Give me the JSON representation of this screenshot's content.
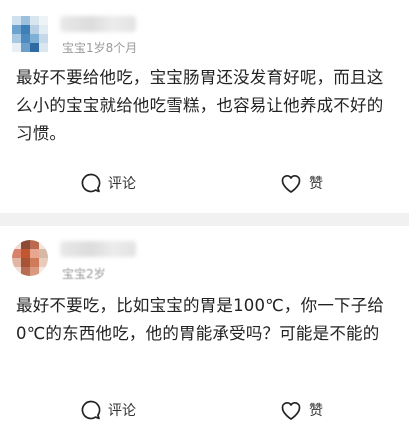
{
  "posts": [
    {
      "subtitle": "宝宝1岁8个月",
      "body": "最好不要给他吃，宝宝肠胃还没发育好呢，而且这么小的宝宝就给他吃雪糕，也容易让他养成不好的习惯。",
      "comment_label": "评论",
      "like_label": "赞"
    },
    {
      "subtitle": "宝宝2岁",
      "body": "最好不要吃，比如宝宝的胃是100℃，你一下子给0℃的东西他吃，他的胃能承受吗？可能是不能的",
      "comment_label": "评论",
      "like_label": "赞"
    }
  ],
  "icons": {
    "comment": "comment-bubble-icon",
    "like": "heart-icon"
  },
  "colors": {
    "separator": "#f1f1f1",
    "subtitle": "#9a9a9a",
    "text": "#222222"
  }
}
